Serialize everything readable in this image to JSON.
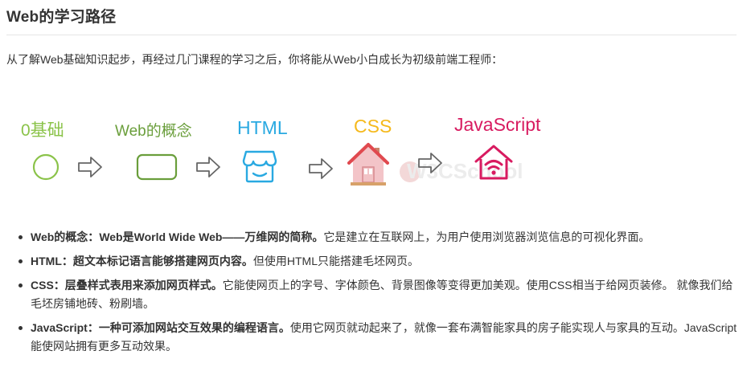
{
  "title": "Web的学习路径",
  "intro": "从了解Web基础知识起步，再经过几门课程的学习之后，你将能从Web小白成长为初级前端工程师：",
  "flow": {
    "steps": [
      {
        "label": "0基础",
        "icon": "circle-icon",
        "color": "#8bc34a"
      },
      {
        "label": "Web的概念",
        "icon": "rounded-rect-icon",
        "color": "#6a9e3b"
      },
      {
        "label": "HTML",
        "icon": "storefront-icon",
        "color": "#29a9e1"
      },
      {
        "label": "CSS",
        "icon": "house-icon",
        "color": "#f5b91c"
      },
      {
        "label": "JavaScript",
        "icon": "smart-home-wifi-icon",
        "color": "#d81b60"
      }
    ],
    "arrow_icon": "right-arrow-icon",
    "watermark": "W3CSchool"
  },
  "bullets": [
    {
      "term": "Web的概念：",
      "bold": "Web是World Wide Web——万维网的简称。",
      "text": "它是建立在互联网上，为用户使用浏览器浏览信息的可视化界面。"
    },
    {
      "term": "HTML：",
      "bold": "超文本标记语言能够搭建网页内容。",
      "text": "但使用HTML只能搭建毛坯网页。"
    },
    {
      "term": "CSS：",
      "bold": "层叠样式表用来添加网页样式。",
      "text": "它能使网页上的字号、字体颜色、背景图像等变得更加美观。使用CSS相当于给网页装修。 就像我们给毛坯房铺地砖、粉刷墙。"
    },
    {
      "term": "JavaScript：",
      "bold": "一种可添加网站交互效果的编程语言。",
      "text": "使用它网页就动起来了，就像一套布满智能家具的房子能实现人与家具的互动。JavaScript能使网站拥有更多互动效果。"
    }
  ]
}
